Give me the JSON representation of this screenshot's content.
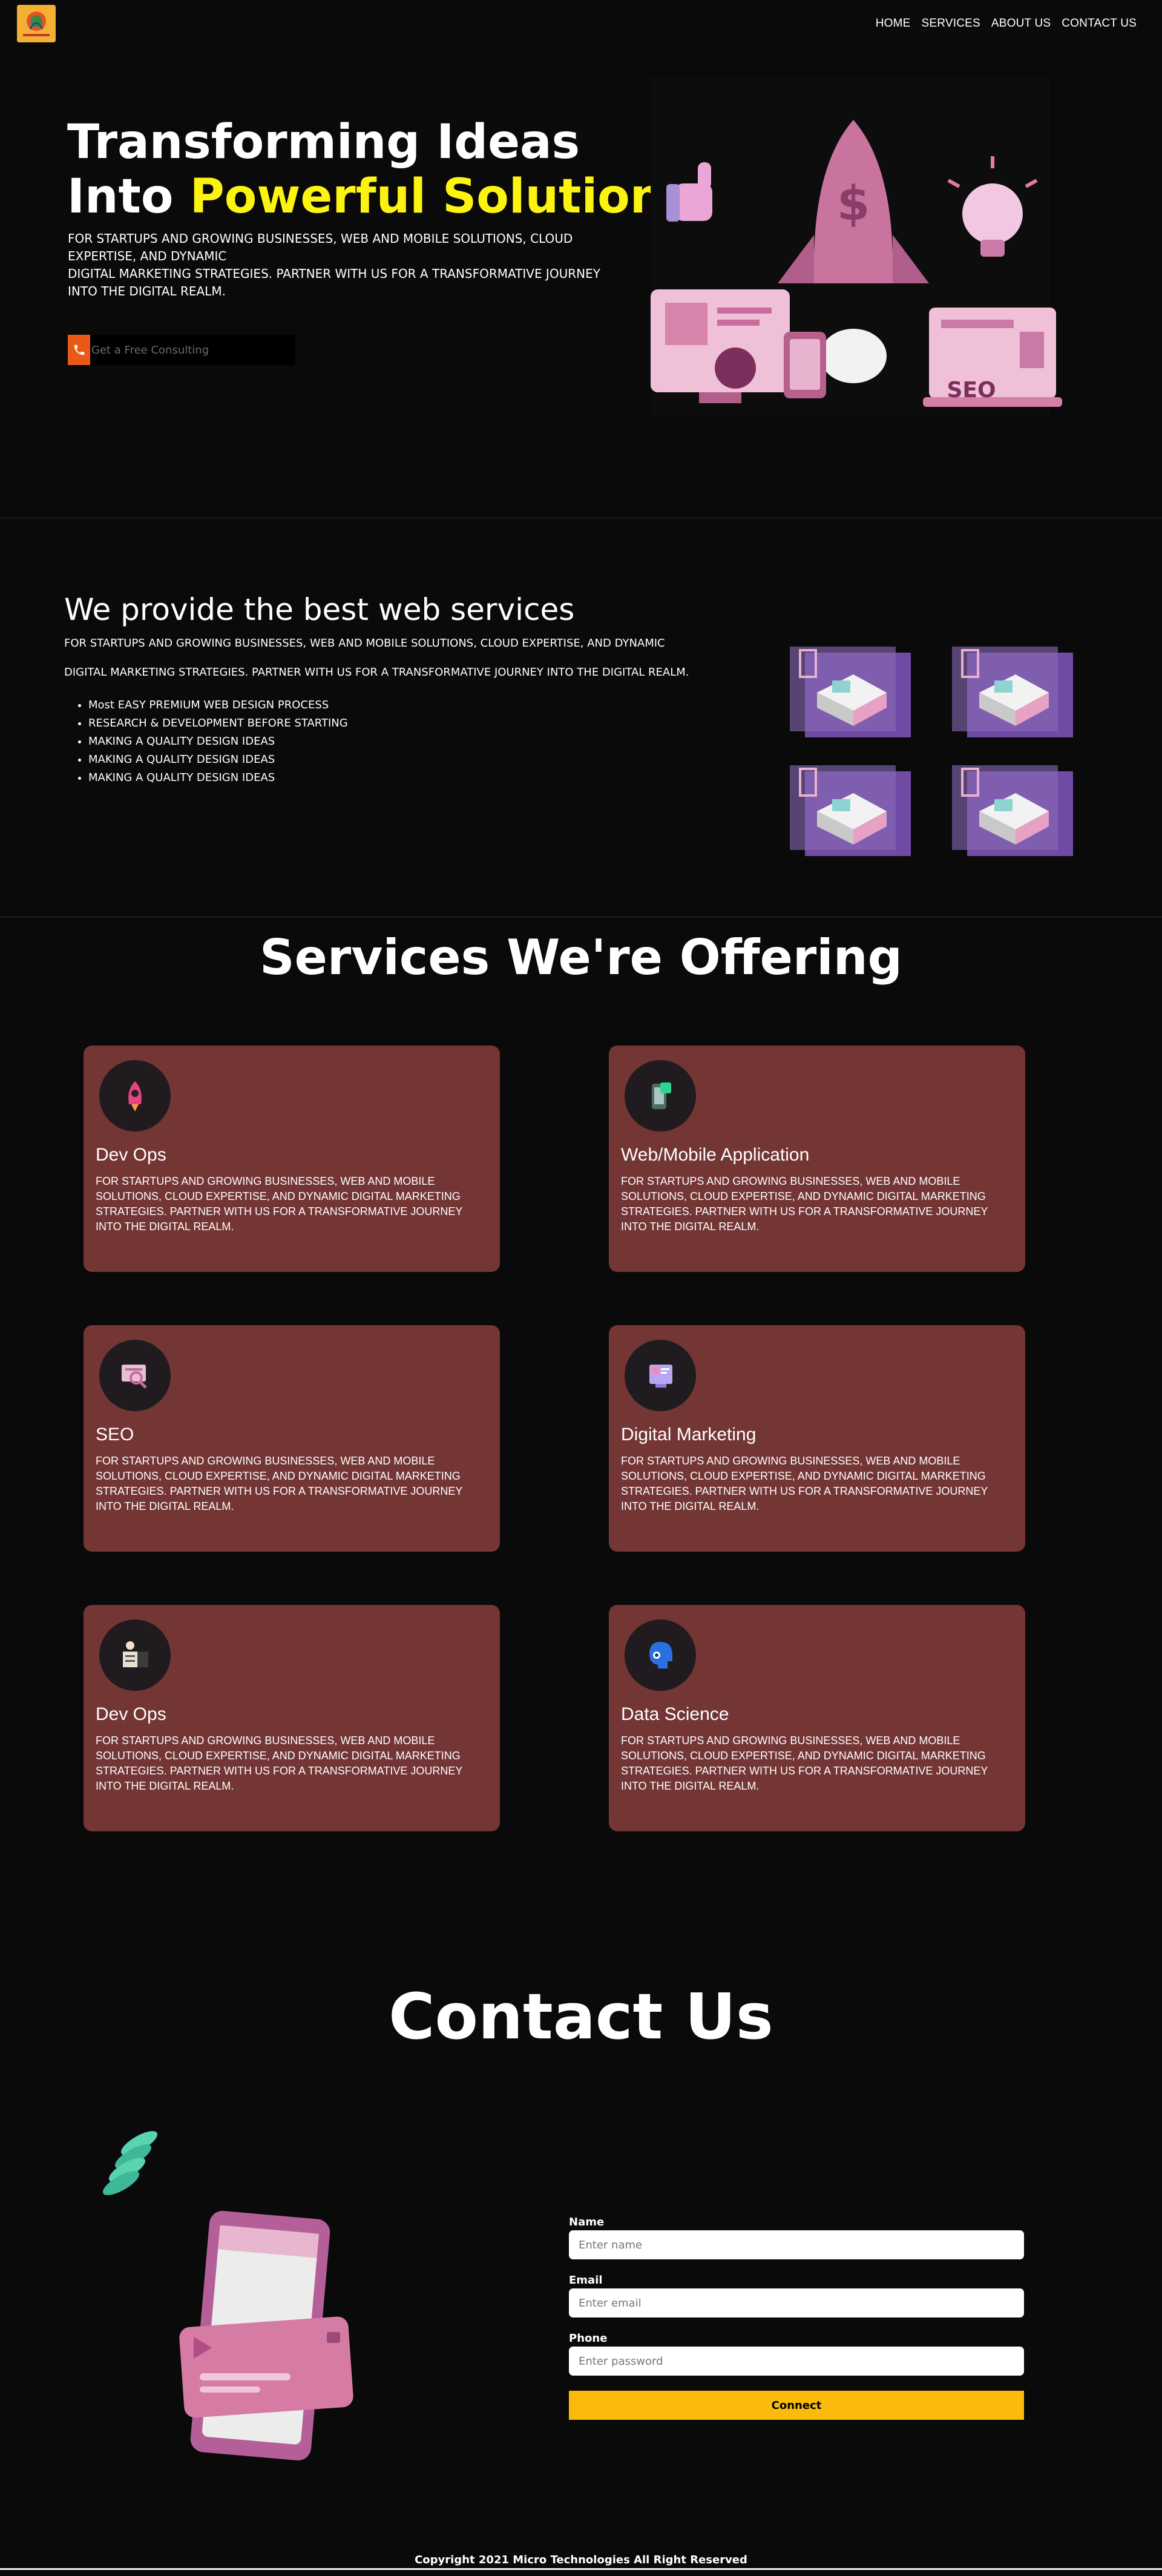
{
  "nav": {
    "links": [
      "HOME",
      "SERVICES",
      "ABOUT US",
      "CONTACT US"
    ]
  },
  "hero": {
    "title_line1": "Transforming Ideas",
    "title_line2_prefix": "Into ",
    "title_line2_highlight": "Powerful Solutions",
    "description_line1": "FOR STARTUPS AND GROWING BUSINESSES, WEB AND MOBILE SOLUTIONS, CLOUD EXPERTISE, AND DYNAMIC",
    "description_line2": "DIGITAL MARKETING STRATEGIES. PARTNER WITH US FOR A TRANSFORMATIVE JOURNEY INTO THE DIGITAL REALM.",
    "consult_placeholder": "Get a Free Consulting",
    "seo_label": "SEO",
    "highlight_color": "#fdf310"
  },
  "web_services": {
    "title": "We provide the best web services",
    "paragraph1": "FOR STARTUPS AND GROWING BUSINESSES, WEB AND MOBILE SOLUTIONS, CLOUD EXPERTISE, AND DYNAMIC",
    "paragraph2": "DIGITAL MARKETING STRATEGIES. PARTNER WITH US FOR A TRANSFORMATIVE JOURNEY INTO THE DIGITAL REALM.",
    "items": [
      "Most EASY PREMIUM WEB DESIGN PROCESS",
      "RESEARCH & DEVELOPMENT BEFORE STARTING",
      "MAKING A QUALITY DESIGN IDEAS",
      "MAKING A QUALITY DESIGN IDEAS",
      "MAKING A QUALITY DESIGN IDEAS"
    ]
  },
  "services": {
    "title": "Services We're Offering",
    "card_color": "#733635",
    "cards": [
      {
        "title": "Dev Ops",
        "icon": "rocket-icon",
        "text": "FOR STARTUPS AND GROWING BUSINESSES, WEB AND MOBILE SOLUTIONS, CLOUD EXPERTISE, AND DYNAMIC DIGITAL MARKETING STRATEGIES. PARTNER WITH US FOR A TRANSFORMATIVE JOURNEY INTO THE DIGITAL REALM."
      },
      {
        "title": "Web/Mobile Application",
        "icon": "mobile-app-icon",
        "text": "FOR STARTUPS AND GROWING BUSINESSES, WEB AND MOBILE SOLUTIONS, CLOUD EXPERTISE, AND DYNAMIC DIGITAL MARKETING STRATEGIES. PARTNER WITH US FOR A TRANSFORMATIVE JOURNEY INTO THE DIGITAL REALM."
      },
      {
        "title": "SEO",
        "icon": "seo-search-icon",
        "text": "FOR STARTUPS AND GROWING BUSINESSES, WEB AND MOBILE SOLUTIONS, CLOUD EXPERTISE, AND DYNAMIC DIGITAL MARKETING STRATEGIES. PARTNER WITH US FOR A TRANSFORMATIVE JOURNEY INTO THE DIGITAL REALM."
      },
      {
        "title": "Digital Marketing",
        "icon": "marketing-screen-icon",
        "text": "FOR STARTUPS AND GROWING BUSINESSES, WEB AND MOBILE SOLUTIONS, CLOUD EXPERTISE, AND DYNAMIC DIGITAL MARKETING STRATEGIES. PARTNER WITH US FOR A TRANSFORMATIVE JOURNEY INTO THE DIGITAL REALM."
      },
      {
        "title": "Dev Ops",
        "icon": "server-icon",
        "text": "FOR STARTUPS AND GROWING BUSINESSES, WEB AND MOBILE SOLUTIONS, CLOUD EXPERTISE, AND DYNAMIC DIGITAL MARKETING STRATEGIES. PARTNER WITH US FOR A TRANSFORMATIVE JOURNEY INTO THE DIGITAL REALM."
      },
      {
        "title": "Data Science",
        "icon": "ai-head-icon",
        "text": "FOR STARTUPS AND GROWING BUSINESSES, WEB AND MOBILE SOLUTIONS, CLOUD EXPERTISE, AND DYNAMIC DIGITAL MARKETING STRATEGIES. PARTNER WITH US FOR A TRANSFORMATIVE JOURNEY INTO THE DIGITAL REALM."
      }
    ]
  },
  "contact": {
    "title": "Contact Us",
    "name_label": "Name",
    "name_placeholder": "Enter name",
    "email_label": "Email",
    "email_placeholder": "Enter email",
    "phone_label": "Phone",
    "phone_placeholder": "Enter password",
    "submit_label": "Connect",
    "button_color": "#fbbb0d"
  },
  "footer": {
    "copyright": "Copyright 2021 Micro Technologies All Right Reserved"
  }
}
